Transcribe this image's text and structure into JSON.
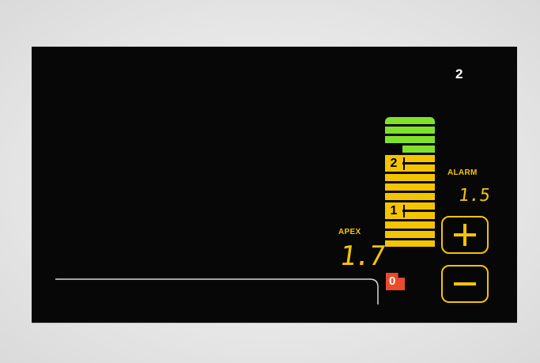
{
  "display": {
    "top_number": "2",
    "alarm": {
      "label": "ALARM",
      "value": "1.5"
    },
    "apex": {
      "label": "APEX",
      "value": "1.7"
    },
    "zero_marker": "0",
    "meter": {
      "markers": [
        "2",
        "1"
      ],
      "green_segments": 4,
      "yellow_segments": 10,
      "colors": {
        "green": "#7fe12a",
        "yellow": "#f5c400",
        "red": "#ea4b2c"
      }
    },
    "buttons": {
      "increase_icon": "plus-icon",
      "decrease_icon": "minus-icon"
    }
  }
}
